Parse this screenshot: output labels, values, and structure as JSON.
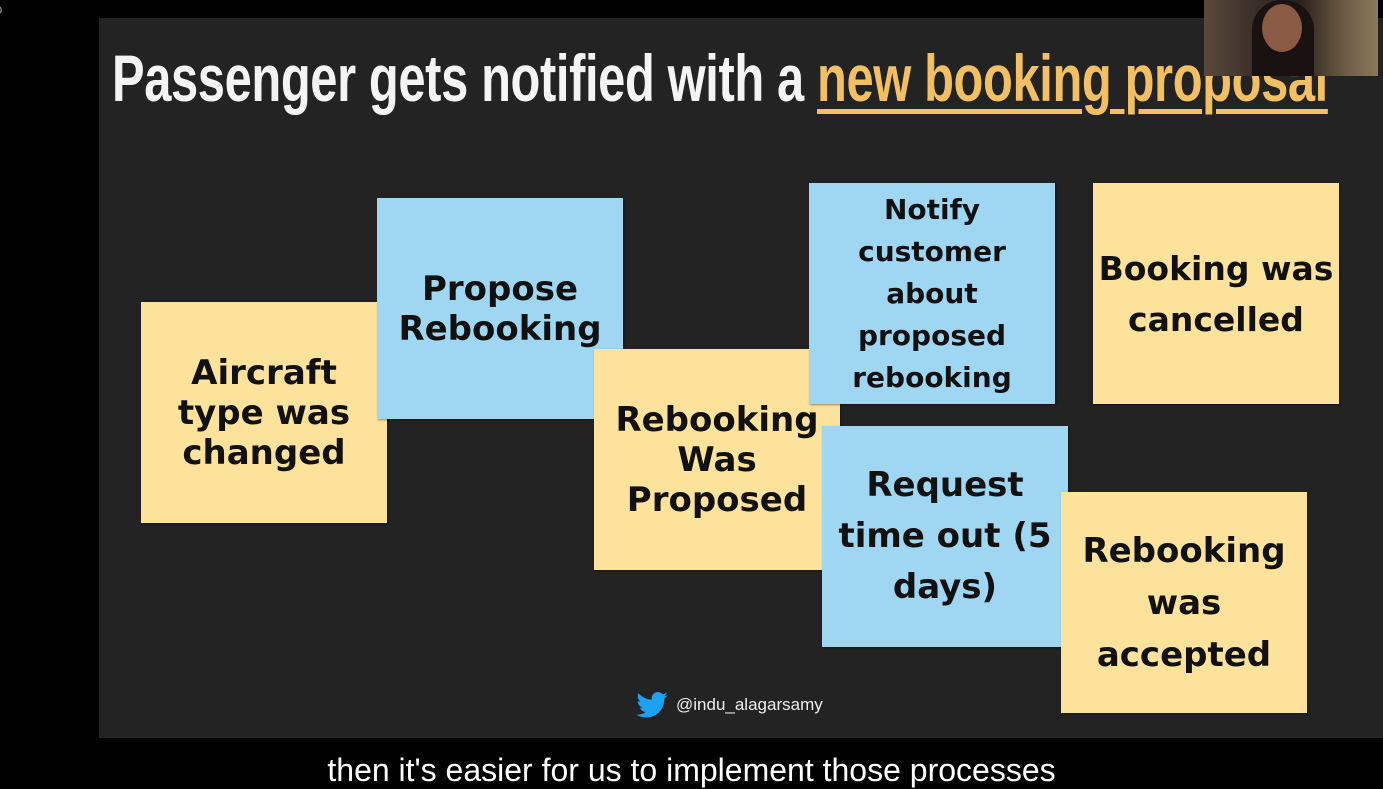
{
  "slide": {
    "title_plain": "Passenger gets notified with a ",
    "title_highlight": "new booking proposal",
    "notes": [
      {
        "text": "Aircraft\ntype was\nchanged",
        "color": "#fde29b",
        "kind": "event"
      },
      {
        "text": "Propose\nRebooking",
        "color": "#9fd7f3",
        "kind": "command"
      },
      {
        "text": "Rebooking\nWas\nProposed",
        "color": "#fde29b",
        "kind": "event"
      },
      {
        "text": "Notify\ncustomer\nabout\nproposed\nrebooking",
        "color": "#9fd7f3",
        "kind": "command"
      },
      {
        "text": "Request\ntime out (5\ndays)",
        "color": "#9fd7f3",
        "kind": "command"
      },
      {
        "text": "Booking was\ncancelled",
        "color": "#fde29b",
        "kind": "event"
      },
      {
        "text": "Rebooking\nwas\naccepted",
        "color": "#fde29b",
        "kind": "event"
      }
    ],
    "twitter_handle": "@indu_alagarsamy",
    "twitter_icon": "twitter-bird-icon",
    "accent_color": "#f2c062"
  },
  "caption": "then it's easier for us to implement those processes"
}
